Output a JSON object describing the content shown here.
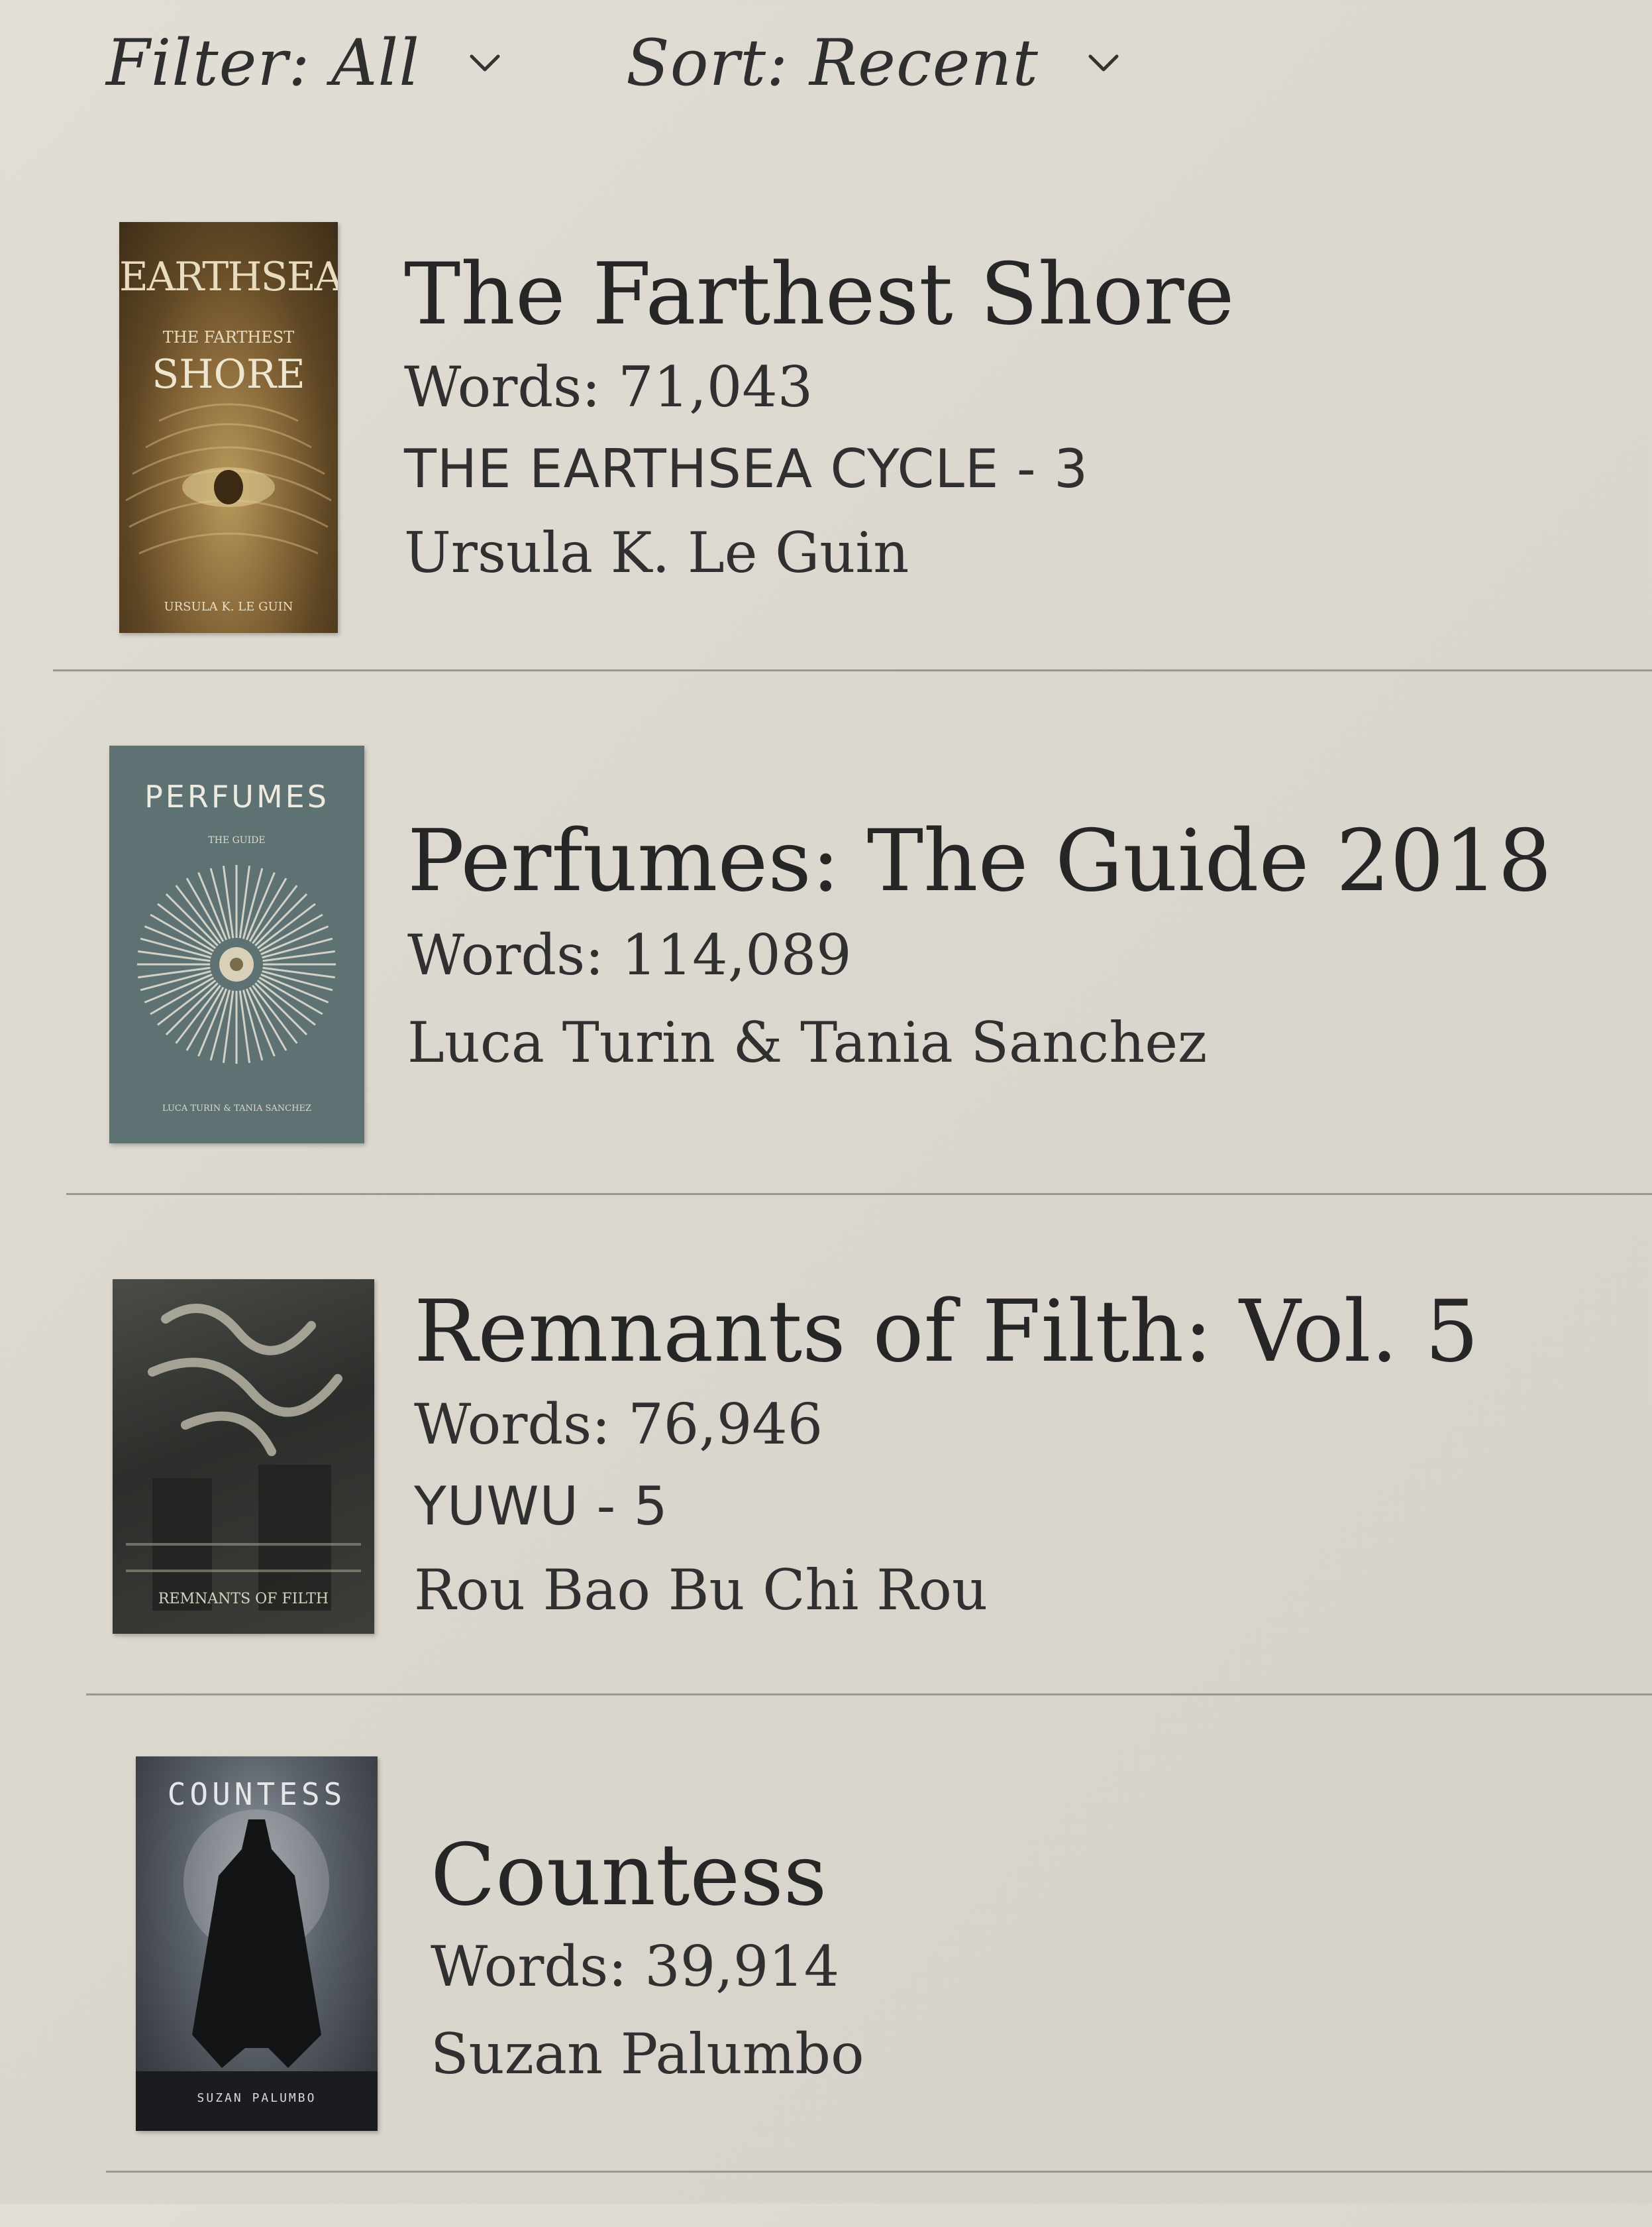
{
  "toolbar": {
    "filter_label": "Filter: All",
    "sort_label": "Sort: Recent"
  },
  "books": [
    {
      "title": "The Farthest Shore",
      "words": "Words: 71,043",
      "series": "THE EARTHSEA CYCLE - 3",
      "author": "Ursula K. Le Guin",
      "cover": {
        "top_text": "EARTHSEA",
        "mid_text": "THE FARTHEST",
        "main_text": "SHORE",
        "bottom_text": "URSULA K. LE GUIN"
      }
    },
    {
      "title": "Perfumes: The Guide 2018",
      "words": "Words: 114,089",
      "author": "Luca Turin & Tania Sanchez",
      "cover": {
        "top_text": "PERFUMES",
        "mid_text": "THE GUIDE",
        "bottom_text": "LUCA TURIN & TANIA SANCHEZ"
      }
    },
    {
      "title": "Remnants of Filth: Vol. 5",
      "words": "Words: 76,946",
      "series": "YUWU - 5",
      "author": "Rou Bao Bu Chi Rou",
      "cover": {
        "bottom_text": "REMNANTS OF FILTH"
      }
    },
    {
      "title": "Countess",
      "words": "Words: 39,914",
      "author": "Suzan Palumbo",
      "cover": {
        "top_text": "COUNTESS",
        "bottom_text": "SUZAN PALUMBO"
      }
    }
  ]
}
